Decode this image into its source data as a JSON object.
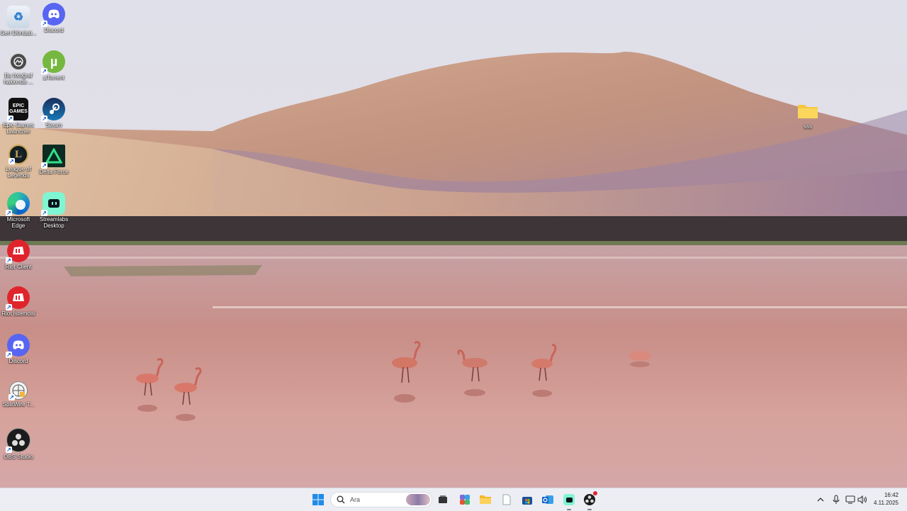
{
  "desktop": {
    "icons": [
      {
        "label": "Geri Dönüşü...",
        "icon": "recycle-bin-icon"
      },
      {
        "label": "Discord",
        "icon": "discord-icon"
      },
      {
        "label": "Bu fotoğraf hakkında ...",
        "icon": "photo-info-icon"
      },
      {
        "label": "µTorrent",
        "icon": "utorrent-icon"
      },
      {
        "label": "Epic Games Launcher",
        "icon": "epic-games-icon",
        "glyph": "EPIC GAMES"
      },
      {
        "label": "Steam",
        "icon": "steam-icon"
      },
      {
        "label": "League of Legends",
        "icon": "league-of-legends-icon",
        "glyph": "L"
      },
      {
        "label": "Delta Force",
        "icon": "delta-force-icon"
      },
      {
        "label": "Microsoft Edge",
        "icon": "edge-icon"
      },
      {
        "label": "Streamlabs Desktop",
        "icon": "streamlabs-icon"
      },
      {
        "label": "Riot Client",
        "icon": "riot-client-icon"
      },
      {
        "label": "Riot İstemcisi",
        "icon": "riot-client-icon"
      },
      {
        "label": "Discord",
        "icon": "discord-icon"
      },
      {
        "label": "SplitWire T...",
        "icon": "splitwire-icon"
      },
      {
        "label": "OBS Studio",
        "icon": "obs-icon"
      },
      {
        "label": "sss",
        "icon": "folder-icon"
      }
    ]
  },
  "taskbar": {
    "start": "start-icon",
    "search_placeholder": "Ara",
    "apps": [
      {
        "name": "task-view",
        "icon": "task-view-icon"
      },
      {
        "name": "widgets-app",
        "icon": "copilot-icon"
      },
      {
        "name": "file-explorer",
        "icon": "folder-icon"
      },
      {
        "name": "notepad",
        "icon": "notepad-icon"
      },
      {
        "name": "microsoft-store",
        "icon": "store-icon"
      },
      {
        "name": "outlook",
        "icon": "outlook-icon"
      },
      {
        "name": "streamlabs",
        "icon": "streamlabs-icon"
      },
      {
        "name": "obs",
        "icon": "obs-icon"
      }
    ],
    "tray": {
      "chevron": "chevron-up-icon",
      "mic": "microphone-icon",
      "network": "network-icon",
      "volume": "volume-icon"
    },
    "clock": {
      "time": "16:42",
      "date": "4.11.2025"
    }
  },
  "colors": {
    "taskbar_bg": "#eceef3",
    "sky": "#d8dde8",
    "mountain": "#c79a86",
    "water": "#c48e8c"
  }
}
